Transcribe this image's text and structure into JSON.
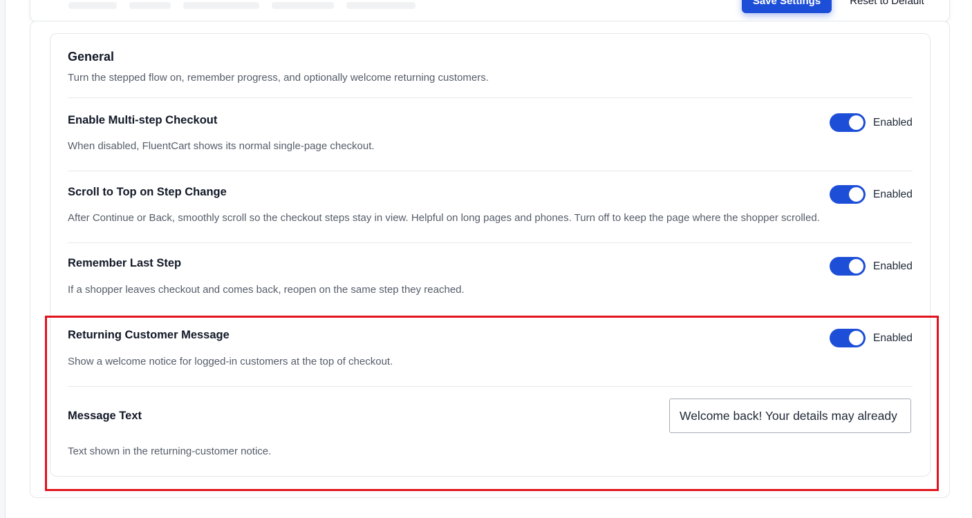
{
  "header": {
    "save_label": "Save Settings",
    "reset_label": "Reset to Default"
  },
  "section": {
    "title": "General",
    "description": "Turn the stepped flow on, remember progress, and optionally welcome returning customers."
  },
  "settings": [
    {
      "title": "Enable Multi-step Checkout",
      "description": "When disabled, FluentCart shows its normal single-page checkout.",
      "enabled": true,
      "toggle_label": "Enabled"
    },
    {
      "title": "Scroll to Top on Step Change",
      "description": "After Continue or Back, smoothly scroll so the checkout steps stay in view. Helpful on long pages and phones. Turn off to keep the page where the shopper scrolled.",
      "enabled": true,
      "toggle_label": "Enabled"
    },
    {
      "title": "Remember Last Step",
      "description": "If a shopper leaves checkout and comes back, reopen on the same step they reached.",
      "enabled": true,
      "toggle_label": "Enabled"
    },
    {
      "title": "Returning Customer Message",
      "description": "Show a welcome notice for logged-in customers at the top of checkout.",
      "enabled": true,
      "toggle_label": "Enabled"
    }
  ],
  "message_text": {
    "label": "Message Text",
    "value": "Welcome back! Your details may already be filled in.",
    "description": "Text shown in the returning-customer notice."
  },
  "colors": {
    "accent": "#1d4ed8",
    "highlight": "#e3131b"
  }
}
